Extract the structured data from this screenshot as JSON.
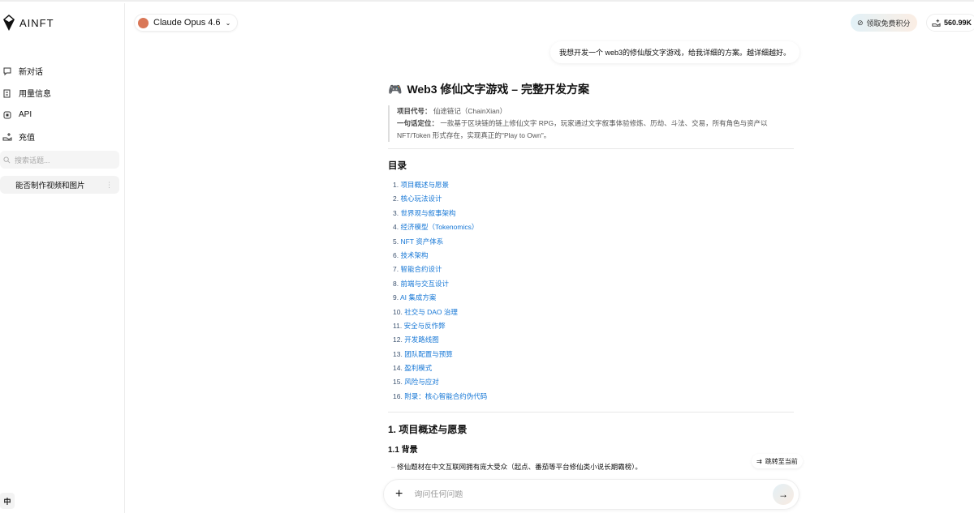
{
  "app": {
    "logo": "AINFT",
    "lang": "中"
  },
  "sidebar": {
    "items": [
      {
        "label": "新对话",
        "icon": "chat-icon"
      },
      {
        "label": "用量信息",
        "icon": "usage-icon"
      },
      {
        "label": "API",
        "icon": "chip-icon"
      },
      {
        "label": "充值",
        "icon": "recharge-icon"
      }
    ],
    "search_placeholder": "搜索话题...",
    "conversations": [
      {
        "title": "能否制作视频和图片"
      }
    ]
  },
  "header": {
    "model": "Claude Opus 4.6",
    "points_label": "领取免费积分",
    "balance": "560.99K"
  },
  "chat": {
    "user_message": "我想开发一个 web3的修仙版文字游戏，给我详细的方案。越详细越好。",
    "title": "Web3 修仙文字游戏 – 完整开发方案",
    "code_label": "项目代号：",
    "code_value": "仙途链记（ChainXian）",
    "pos_label": "一句话定位：",
    "pos_value": "一款基于区块链的链上修仙文字 RPG，玩家通过文字叙事体验修炼、历劫、斗法、交易，所有角色与资产以 NFT/Token 形式存在，实现真正的\"Play to Own\"。",
    "toc_title": "目录",
    "toc": [
      {
        "n": "1.",
        "t": "项目概述与愿景"
      },
      {
        "n": "2.",
        "t": "核心玩法设计"
      },
      {
        "n": "3.",
        "t": "世界观与叙事架构"
      },
      {
        "n": "4.",
        "t": "经济模型（Tokenomics）"
      },
      {
        "n": "5.",
        "t": "NFT 资产体系"
      },
      {
        "n": "6.",
        "t": "技术架构"
      },
      {
        "n": "7.",
        "t": "智能合约设计"
      },
      {
        "n": "8.",
        "t": "前端与交互设计"
      },
      {
        "n": "9.",
        "t": "AI 集成方案"
      },
      {
        "n": "10.",
        "t": "社交与 DAO 治理"
      },
      {
        "n": "11.",
        "t": "安全与反作弊"
      },
      {
        "n": "12.",
        "t": "开发路线图"
      },
      {
        "n": "13.",
        "t": "团队配置与预算"
      },
      {
        "n": "14.",
        "t": "盈利模式"
      },
      {
        "n": "15.",
        "t": "风险与应对"
      },
      {
        "n": "16.",
        "t": "附录：核心智能合约伪代码"
      }
    ],
    "section1": "1. 项目概述与愿景",
    "sub1": "1.1 背景",
    "bullet1": "修仙题材在中文互联网拥有庞大受众（起点、番茄等平台修仙类小说长期霸榜）。",
    "jump_label": "跳转至当前"
  },
  "input": {
    "placeholder": "询问任何问题"
  }
}
